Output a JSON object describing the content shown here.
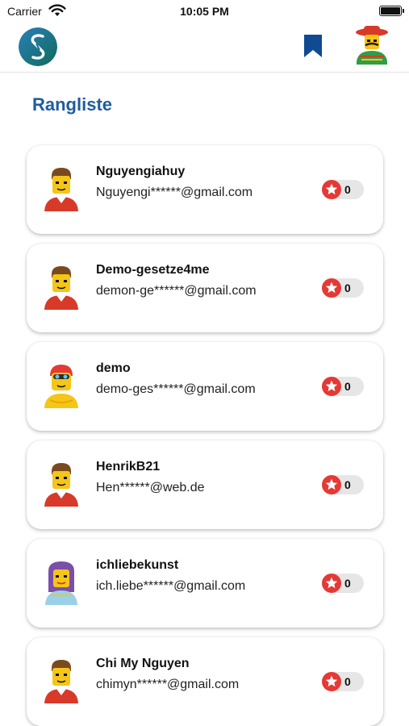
{
  "status": {
    "carrier": "Carrier",
    "time": "10:05 PM"
  },
  "header": {
    "logo_icon": "logo-icon",
    "bookmark_icon": "bookmark-icon",
    "profile_icon": "avatar-icon"
  },
  "title": "Rangliste",
  "colors": {
    "accent": "#1f5c9e",
    "star": "#e53935",
    "bookmark": "#0f4a93"
  },
  "users": [
    {
      "name": "Nguyengiahuy",
      "email": "Nguyengi******@gmail.com",
      "score": "0",
      "avatar": "man-avatar"
    },
    {
      "name": "Demo-gesetze4me",
      "email": "demon-ge******@gmail.com",
      "score": "0",
      "avatar": "man-avatar"
    },
    {
      "name": "demo",
      "email": "demo-ges******@gmail.com",
      "score": "0",
      "avatar": "swimmer-avatar"
    },
    {
      "name": "HenrikB21",
      "email": "Hen******@web.de",
      "score": "0",
      "avatar": "man-avatar"
    },
    {
      "name": "ichliebekunst",
      "email": "ich.liebe******@gmail.com",
      "score": "0",
      "avatar": "woman-avatar"
    },
    {
      "name": "Chi My Nguyen",
      "email": "chimyn******@gmail.com",
      "score": "0",
      "avatar": "man-avatar"
    }
  ]
}
